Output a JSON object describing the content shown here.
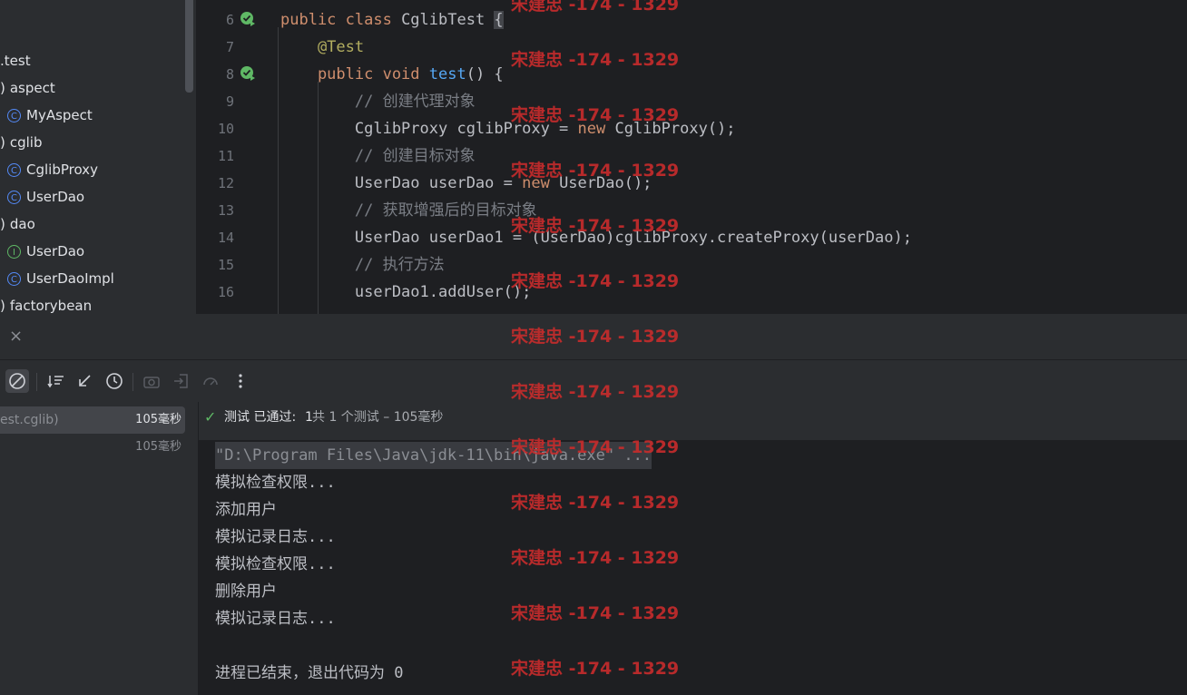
{
  "project_tree": {
    "items": [
      {
        "label": ".test",
        "kind": "package-fragment"
      },
      {
        "label": "aspect",
        "kind": "package"
      },
      {
        "label": "MyAspect",
        "kind": "class"
      },
      {
        "label": "cglib",
        "kind": "package"
      },
      {
        "label": "CglibProxy",
        "kind": "class"
      },
      {
        "label": "UserDao",
        "kind": "class"
      },
      {
        "label": "dao",
        "kind": "package"
      },
      {
        "label": "UserDao",
        "kind": "interface"
      },
      {
        "label": "UserDaoImpl",
        "kind": "class"
      },
      {
        "label": "factorybean",
        "kind": "package"
      }
    ]
  },
  "editor": {
    "lines": [
      {
        "num": "6",
        "tokens": [
          [
            "kw",
            "public class "
          ],
          [
            "t",
            "CglibTest "
          ],
          [
            "t",
            "{"
          ]
        ]
      },
      {
        "num": "7",
        "tokens": [
          [
            "an",
            "    @Test"
          ]
        ]
      },
      {
        "num": "8",
        "tokens": [
          [
            "kw",
            "    public void "
          ],
          [
            "fn",
            "test"
          ],
          [
            "t",
            "() {"
          ]
        ]
      },
      {
        "num": "9",
        "tokens": [
          [
            "cm",
            "        // 创建代理对象"
          ]
        ]
      },
      {
        "num": "10",
        "tokens": [
          [
            "t",
            "        CglibProxy cglibProxy = "
          ],
          [
            "kw",
            "new "
          ],
          [
            "t",
            "CglibProxy();"
          ]
        ]
      },
      {
        "num": "11",
        "tokens": [
          [
            "cm",
            "        // 创建目标对象"
          ]
        ]
      },
      {
        "num": "12",
        "tokens": [
          [
            "t",
            "        UserDao userDao = "
          ],
          [
            "kw",
            "new "
          ],
          [
            "t",
            "UserDao();"
          ]
        ]
      },
      {
        "num": "13",
        "tokens": [
          [
            "cm",
            "        // 获取增强后的目标对象"
          ]
        ]
      },
      {
        "num": "14",
        "tokens": [
          [
            "t",
            "        UserDao userDao1 = (UserDao)cglibProxy.createProxy(userDao);"
          ]
        ]
      },
      {
        "num": "15",
        "tokens": [
          [
            "cm",
            "        // 执行方法"
          ]
        ]
      },
      {
        "num": "16",
        "tokens": [
          [
            "t",
            "        userDao1.addUser();"
          ]
        ]
      }
    ]
  },
  "tool_window": {
    "close_glyph": "×",
    "tests": [
      {
        "label": "est.cglib)",
        "time": "105毫秒",
        "selected": true
      },
      {
        "label": "",
        "time": "105毫秒",
        "selected": false
      }
    ],
    "status": {
      "check": "✓",
      "passed_label": "测试 已通过:",
      "passed_count": "1",
      "summary": "共 1 个测试 – 105毫秒"
    },
    "console_lines": [
      "\"D:\\Program Files\\Java\\jdk-11\\bin\\java.exe\" ...",
      "模拟检查权限...",
      "添加用户",
      "模拟记录日志...",
      "模拟检查权限...",
      "删除用户",
      "模拟记录日志...",
      "",
      "进程已结束，退出代码为 0"
    ]
  },
  "watermark": "宋建忠 -174 - 1329",
  "colors": {
    "keyword": "#cf8e6d",
    "annotation": "#b3ae60",
    "function": "#56a8f5",
    "comment": "#7a7e85",
    "watermark": "#c82c2c"
  }
}
